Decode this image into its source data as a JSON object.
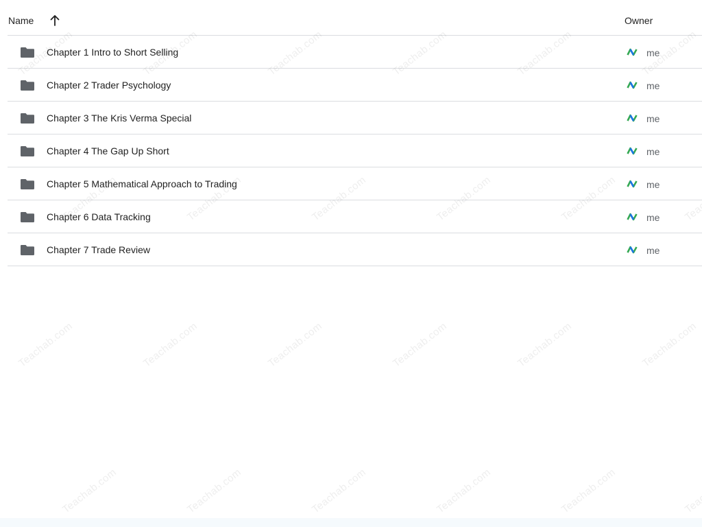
{
  "header": {
    "name_label": "Name",
    "owner_label": "Owner",
    "sort_icon": "arrow-upward-icon"
  },
  "rows": [
    {
      "name": "Chapter 1 Intro to Short Selling",
      "owner": "me",
      "icon": "folder-icon"
    },
    {
      "name": "Chapter 2 Trader Psychology",
      "owner": "me",
      "icon": "folder-icon"
    },
    {
      "name": "Chapter 3 The Kris Verma Special",
      "owner": "me",
      "icon": "folder-icon"
    },
    {
      "name": "Chapter 4 The Gap Up Short",
      "owner": "me",
      "icon": "folder-icon"
    },
    {
      "name": "Chapter 5 Mathematical Approach to Trading",
      "owner": "me",
      "icon": "folder-icon"
    },
    {
      "name": "Chapter 6 Data Tracking",
      "owner": "me",
      "icon": "folder-icon"
    },
    {
      "name": "Chapter 7 Trade Review",
      "owner": "me",
      "icon": "folder-icon"
    }
  ],
  "watermark": {
    "text": "Teachab.com"
  },
  "colors": {
    "folder": "#5f6368",
    "divider": "#dadce0",
    "avatar_green": "#34a853",
    "avatar_blue": "#1a73e8"
  }
}
